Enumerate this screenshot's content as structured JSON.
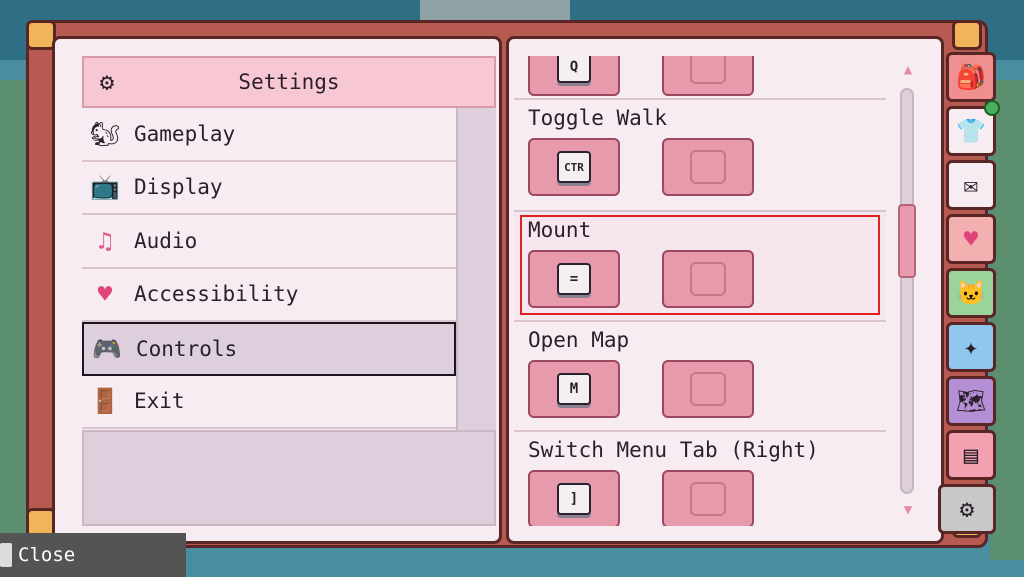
{
  "menu": {
    "header": {
      "label": "Settings",
      "icon": "gear-icon"
    },
    "items": [
      {
        "label": "Gameplay",
        "icon": "squirrel-icon"
      },
      {
        "label": "Display",
        "icon": "tv-icon"
      },
      {
        "label": "Audio",
        "icon": "music-note-icon"
      },
      {
        "label": "Accessibility",
        "icon": "heart-icon"
      },
      {
        "label": "Controls",
        "icon": "gamepad-icon",
        "selected": true
      },
      {
        "label": "Exit",
        "icon": "door-icon"
      }
    ]
  },
  "controls": {
    "top_key": "Q",
    "bindings": [
      {
        "label": "Toggle Walk",
        "primary": "CTR"
      },
      {
        "label": "Mount",
        "primary": "="
      },
      {
        "label": "Open Map",
        "primary": "M"
      },
      {
        "label": "Switch Menu Tab (Right)",
        "primary": "]"
      }
    ]
  },
  "side_tabs": [
    {
      "icon": "backpack-icon",
      "color": "#ef8f8f"
    },
    {
      "icon": "shirt-icon",
      "color": "#f6ecf2",
      "notification": true
    },
    {
      "icon": "mail-icon",
      "color": "#f6ecf2"
    },
    {
      "icon": "heart-icon",
      "color": "#f3b0b0"
    },
    {
      "icon": "cat-icon",
      "color": "#9bd49b"
    },
    {
      "icon": "sparkle-icon",
      "color": "#8fc7ee"
    },
    {
      "icon": "map-icon",
      "color": "#b58fd6"
    },
    {
      "icon": "journal-icon",
      "color": "#f3a0b0"
    },
    {
      "icon": "gear-icon",
      "color": "#c8c8c8",
      "active": true
    }
  ],
  "footer": {
    "close_label": "Close"
  }
}
